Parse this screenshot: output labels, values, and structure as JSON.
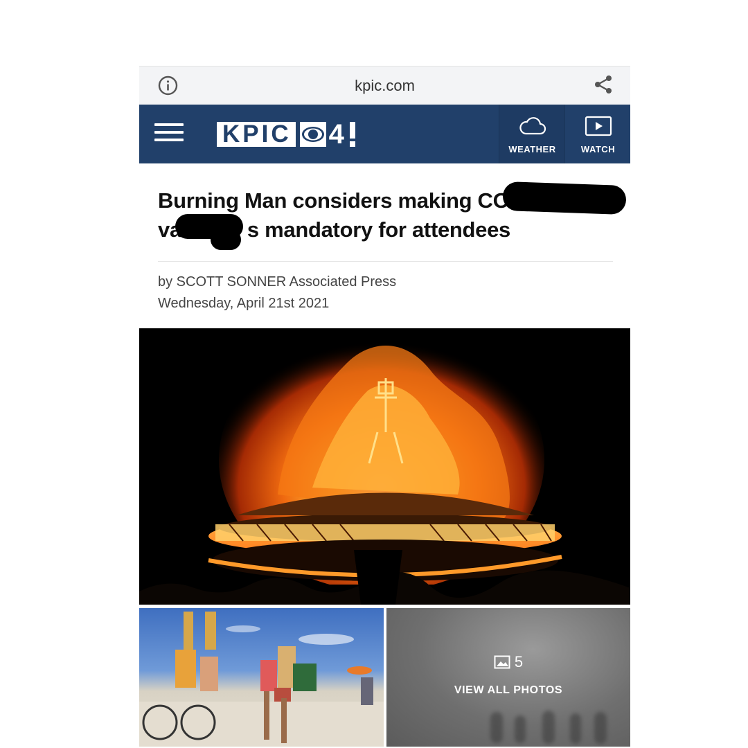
{
  "browser": {
    "domain": "kpic.com",
    "info_icon": "info-circle-icon",
    "share_icon": "share-icon"
  },
  "header": {
    "menu_icon": "hamburger-menu-icon",
    "logo_text": "KPIC",
    "logo_number": "4",
    "weather_label": "WEATHER",
    "watch_label": "WATCH",
    "background_color": "#21406a"
  },
  "article": {
    "headline_line1": "Burning Man considers making CO",
    "headline_line2_start": "va",
    "headline_line2_end": "s mandatory for attendees",
    "byline": "by SCOTT SONNER Associated Press",
    "date": "Wednesday, April 21st 2021"
  },
  "gallery": {
    "photo_count": "5",
    "view_all_label": "VIEW ALL PHOTOS"
  }
}
